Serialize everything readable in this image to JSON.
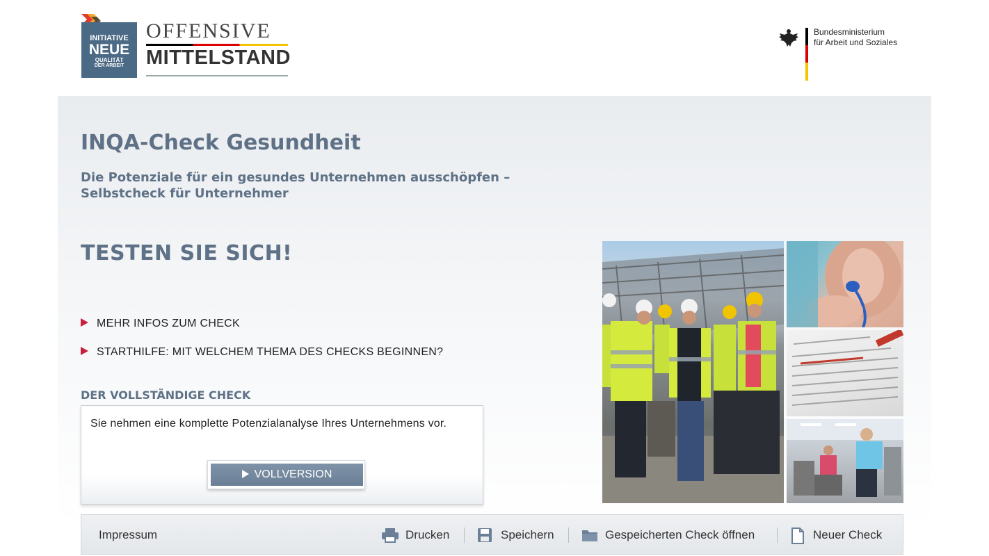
{
  "header": {
    "inqa_logo": {
      "line1": "INITIATIVE",
      "line2": "NEUE",
      "line3": "QUALITÄT",
      "line4": "DER ARBEIT"
    },
    "offensive": "OFFENSIVE",
    "mittelstand": "MITTELSTAND",
    "ministry_line1": "Bundesministerium",
    "ministry_line2": "für Arbeit und Soziales"
  },
  "main": {
    "title": "INQA-Check Gesundheit",
    "subtitle_line1": "Die Potenziale für ein gesundes Unternehmen ausschöpfen –",
    "subtitle_line2": "Selbstcheck für Unternehmer",
    "cta_title": "TESTEN SIE SICH!",
    "links": [
      {
        "label": "MEHR INFOS ZUM CHECK"
      },
      {
        "label": "STARTHILFE: MIT WELCHEM THEMA DES CHECKS BEGINNEN?"
      }
    ],
    "section_label": "DER VOLLSTÄNDIGE CHECK",
    "card_text": "Sie nehmen eine komplette Potenzialanalyse Ihres Unternehmens vor.",
    "button_label": "VOLLVERSION"
  },
  "footer": {
    "impressum": "Impressum",
    "print": "Drucken",
    "save": "Speichern",
    "open_saved": "Gespeicherten Check öffnen",
    "new_check": "Neuer Check"
  },
  "colors": {
    "heading": "#5e7186",
    "accent_red": "#c8203c",
    "button": "#6a7f96"
  }
}
